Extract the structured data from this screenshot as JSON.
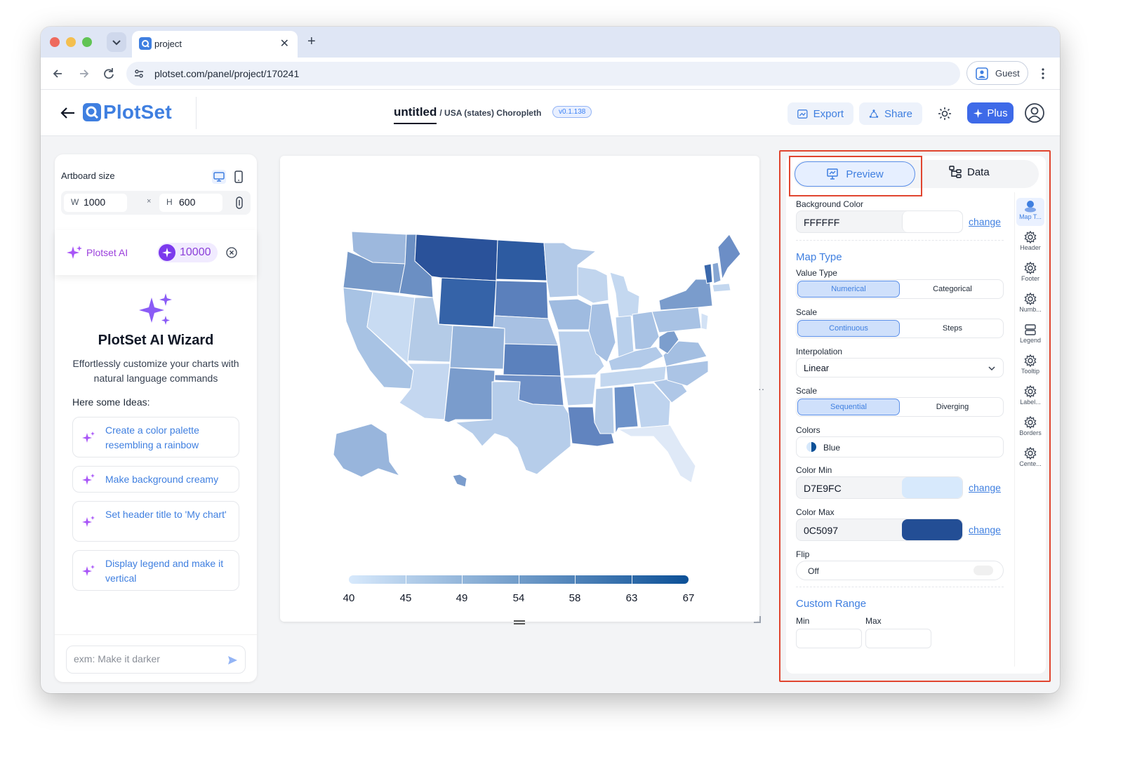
{
  "browser": {
    "tab_title": "project",
    "url": "plotset.com/panel/project/170241",
    "profile_label": "Guest"
  },
  "app": {
    "logo_text": "PlotSet",
    "project_name": "untitled",
    "project_subtitle": "/ USA (states) Choropleth",
    "version": "v0.1.138",
    "export_label": "Export",
    "share_label": "Share",
    "plus_label": "Plus",
    "colors": {
      "brand": "#3f7fe0",
      "ai": "#9b3fdc",
      "highlight": "#e0452f"
    }
  },
  "left_panel": {
    "artboard_label": "Artboard size",
    "width_key": "W",
    "width_value": "1000",
    "height_key": "H",
    "height_value": "600",
    "times_symbol": "×",
    "ai_label": "Plotset AI",
    "credits": "10000",
    "wizard_title": "PlotSet AI Wizard",
    "wizard_desc": "Effortlessly customize your charts with natural language commands",
    "ideas_label": "Here some Ideas:",
    "ideas": [
      "Create a color palette resembling a rainbow",
      "Make background creamy",
      "Set header title to 'My chart'",
      "Display legend and make it vertical"
    ],
    "prompt_placeholder": "exm: Make it darker"
  },
  "canvas": {
    "legend_labels": [
      "40",
      "45",
      "49",
      "54",
      "58",
      "63",
      "67"
    ],
    "color_min": "#D7E9FC",
    "color_max": "#0C5097"
  },
  "right_panel": {
    "tab_preview": "Preview",
    "tab_data": "Data",
    "background_color_label": "Background Color",
    "background_color_value": "FFFFFF",
    "change_label": "change",
    "map_type_title": "Map Type",
    "value_type_label": "Value Type",
    "value_type_options": [
      "Numerical",
      "Categorical"
    ],
    "scale_label": "Scale",
    "scale_options": [
      "Continuous",
      "Steps"
    ],
    "interpolation_label": "Interpolation",
    "interpolation_value": "Linear",
    "scale2_label": "Scale",
    "scale2_options": [
      "Sequential",
      "Diverging"
    ],
    "colors_label": "Colors",
    "colors_value": "Blue",
    "color_min_label": "Color Min",
    "color_min_value": "D7E9FC",
    "color_max_label": "Color Max",
    "color_max_value": "0C5097",
    "flip_label": "Flip",
    "flip_value": "Off",
    "custom_range_title": "Custom Range",
    "min_label": "Min",
    "max_label": "Max",
    "rail": [
      "Map T...",
      "Header",
      "Footer",
      "Numb...",
      "Legend",
      "Tooltip",
      "Label...",
      "Borders",
      "Cente..."
    ]
  }
}
